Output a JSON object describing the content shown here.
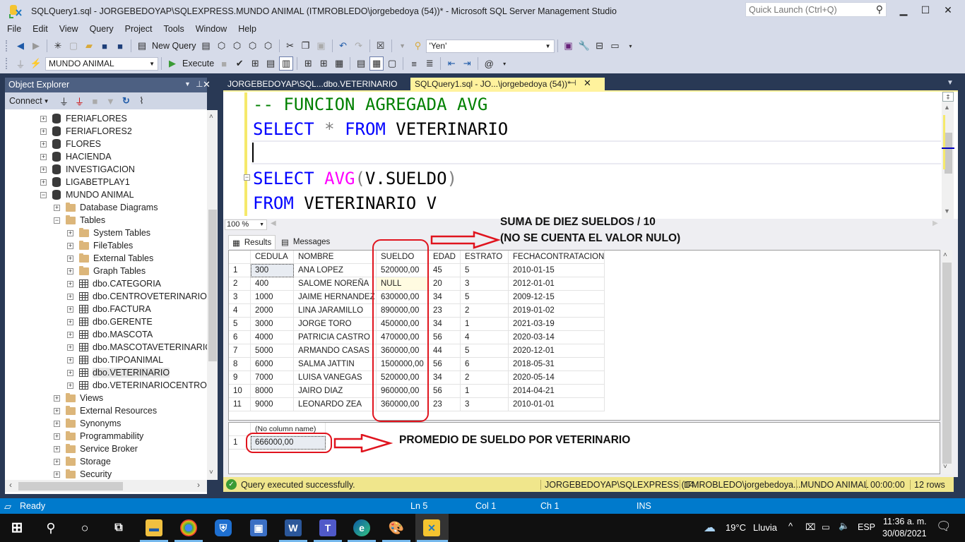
{
  "window": {
    "title": "SQLQuery1.sql - JORGEBEDOYAP\\SQLEXPRESS.MUNDO ANIMAL (ITMROBLEDO\\jorgebedoya (54))* - Microsoft SQL Server Management Studio",
    "quick_launch_placeholder": "Quick Launch (Ctrl+Q)",
    "minimize": "▁",
    "maximize": "☐",
    "close": "✕"
  },
  "menu": [
    "File",
    "Edit",
    "View",
    "Query",
    "Project",
    "Tools",
    "Window",
    "Help"
  ],
  "toolbar1": {
    "new_query_label": "New Query",
    "find_combo_value": "'Yen'"
  },
  "toolbar2": {
    "database_combo_value": "MUNDO ANIMAL",
    "execute_label": "Execute"
  },
  "object_explorer": {
    "title": "Object Explorer",
    "connect_label": "Connect",
    "items": [
      {
        "label": "FERIAFLORES",
        "type": "db",
        "level": 0,
        "expander": "+"
      },
      {
        "label": "FERIAFLORES2",
        "type": "db",
        "level": 0,
        "expander": "+"
      },
      {
        "label": "FLORES",
        "type": "db",
        "level": 0,
        "expander": "+"
      },
      {
        "label": "HACIENDA",
        "type": "db",
        "level": 0,
        "expander": "+"
      },
      {
        "label": "INVESTIGACION",
        "type": "db",
        "level": 0,
        "expander": "+"
      },
      {
        "label": "LIGABETPLAY1",
        "type": "db",
        "level": 0,
        "expander": "+"
      },
      {
        "label": "MUNDO ANIMAL",
        "type": "db",
        "level": 0,
        "expander": "−"
      },
      {
        "label": "Database Diagrams",
        "type": "folder",
        "level": 1,
        "expander": "+"
      },
      {
        "label": "Tables",
        "type": "folder",
        "level": 1,
        "expander": "−"
      },
      {
        "label": "System Tables",
        "type": "folder",
        "level": 2,
        "expander": "+"
      },
      {
        "label": "FileTables",
        "type": "folder",
        "level": 2,
        "expander": "+"
      },
      {
        "label": "External Tables",
        "type": "folder",
        "level": 2,
        "expander": "+"
      },
      {
        "label": "Graph Tables",
        "type": "folder",
        "level": 2,
        "expander": "+"
      },
      {
        "label": "dbo.CATEGORIA",
        "type": "table",
        "level": 2,
        "expander": "+"
      },
      {
        "label": "dbo.CENTROVETERINARIO",
        "type": "table",
        "level": 2,
        "expander": "+"
      },
      {
        "label": "dbo.FACTURA",
        "type": "table",
        "level": 2,
        "expander": "+"
      },
      {
        "label": "dbo.GERENTE",
        "type": "table",
        "level": 2,
        "expander": "+"
      },
      {
        "label": "dbo.MASCOTA",
        "type": "table",
        "level": 2,
        "expander": "+"
      },
      {
        "label": "dbo.MASCOTAVETERINARIO",
        "type": "table",
        "level": 2,
        "expander": "+"
      },
      {
        "label": "dbo.TIPOANIMAL",
        "type": "table",
        "level": 2,
        "expander": "+"
      },
      {
        "label": "dbo.VETERINARIO",
        "type": "table",
        "level": 2,
        "expander": "+",
        "selected": true
      },
      {
        "label": "dbo.VETERINARIOCENTRO",
        "type": "table",
        "level": 2,
        "expander": "+"
      },
      {
        "label": "Views",
        "type": "folder",
        "level": 1,
        "expander": "+"
      },
      {
        "label": "External Resources",
        "type": "folder",
        "level": 1,
        "expander": "+"
      },
      {
        "label": "Synonyms",
        "type": "folder",
        "level": 1,
        "expander": "+"
      },
      {
        "label": "Programmability",
        "type": "folder",
        "level": 1,
        "expander": "+"
      },
      {
        "label": "Service Broker",
        "type": "folder",
        "level": 1,
        "expander": "+"
      },
      {
        "label": "Storage",
        "type": "folder",
        "level": 1,
        "expander": "+"
      },
      {
        "label": "Security",
        "type": "folder",
        "level": 1,
        "expander": "+"
      }
    ]
  },
  "tabs": [
    {
      "label": "JORGEBEDOYAP\\SQL...dbo.VETERINARIO",
      "active": false
    },
    {
      "label": "SQLQuery1.sql - JO...\\jorgebedoya (54))*",
      "active": true
    }
  ],
  "editor": {
    "lines": [
      {
        "comment": "-- FUNCION AGREGADA AVG"
      },
      {
        "kw1": "SELECT",
        "op": " * ",
        "kw2": "FROM",
        "rest": " VETERINARIO"
      },
      {
        "blank": ""
      },
      {
        "kw1": "SELECT ",
        "fn": "AVG",
        "p1": "(",
        "mid": "V.SUELDO",
        "p2": ")"
      },
      {
        "kw1": "FROM",
        "rest": " VETERINARIO V"
      }
    ],
    "zoom_level": "100 %"
  },
  "results": {
    "tab_results": "Results",
    "tab_messages": "Messages",
    "grid1": {
      "columns": [
        "CEDULA",
        "NOMBRE",
        "SUELDO",
        "EDAD",
        "ESTRATO",
        "FECHACONTRATACION"
      ],
      "rows": [
        [
          "1",
          "300",
          "ANA LOPEZ",
          "520000,00",
          "45",
          "5",
          "2010-01-15"
        ],
        [
          "2",
          "400",
          "SALOME NOREÑA",
          "NULL",
          "20",
          "3",
          "2012-01-01"
        ],
        [
          "3",
          "1000",
          "JAIME HERNANDEZ",
          "630000,00",
          "34",
          "5",
          "2009-12-15"
        ],
        [
          "4",
          "2000",
          "LINA JARAMILLO",
          "890000,00",
          "23",
          "2",
          "2019-01-02"
        ],
        [
          "5",
          "3000",
          "JORGE TORO",
          "450000,00",
          "34",
          "1",
          "2021-03-19"
        ],
        [
          "6",
          "4000",
          "PATRICIA CASTRO",
          "470000,00",
          "56",
          "4",
          "2020-03-14"
        ],
        [
          "7",
          "5000",
          "ARMANDO CASAS",
          "360000,00",
          "44",
          "5",
          "2020-12-01"
        ],
        [
          "8",
          "6000",
          "SALMA JATTIN",
          "1500000,00",
          "56",
          "6",
          "2018-05-31"
        ],
        [
          "9",
          "7000",
          "LUISA VANEGAS",
          "520000,00",
          "34",
          "2",
          "2020-05-14"
        ],
        [
          "10",
          "8000",
          "JAIRO DIAZ",
          "960000,00",
          "56",
          "1",
          "2014-04-21"
        ],
        [
          "11",
          "9000",
          "LEONARDO ZEA",
          "360000,00",
          "23",
          "3",
          "2010-01-01"
        ]
      ]
    },
    "grid2": {
      "columns": [
        "(No column name)"
      ],
      "rows": [
        [
          "1",
          "666000,00"
        ]
      ]
    }
  },
  "annotations": {
    "top_line1": "SUMA DE DIEZ SUELDOS / 10",
    "top_line2": "(NO SE CUENTA EL VALOR NULO)",
    "bottom": "PROMEDIO DE SUELDO POR VETERINARIO"
  },
  "query_status": {
    "message": "Query executed successfully.",
    "server": "JORGEBEDOYAP\\SQLEXPRESS (14...",
    "user": "ITMROBLEDO\\jorgebedoya...",
    "database": "MUNDO ANIMAL",
    "elapsed": "00:00:00",
    "rows": "12 rows"
  },
  "statusbar": {
    "ready": "Ready",
    "ln": "Ln 5",
    "col": "Col 1",
    "ch": "Ch 1",
    "mode": "INS"
  },
  "taskbar": {
    "apps": [
      "start",
      "search",
      "cortana",
      "task-view",
      "file-explorer",
      "chrome",
      "security",
      "remote-desktop",
      "word",
      "teams",
      "edge",
      "paint",
      "ssms"
    ],
    "weather_temp": "19°C",
    "weather_desc": "Lluvia",
    "language": "ESP",
    "time": "11:36 a. m.",
    "date": "30/08/2021"
  }
}
